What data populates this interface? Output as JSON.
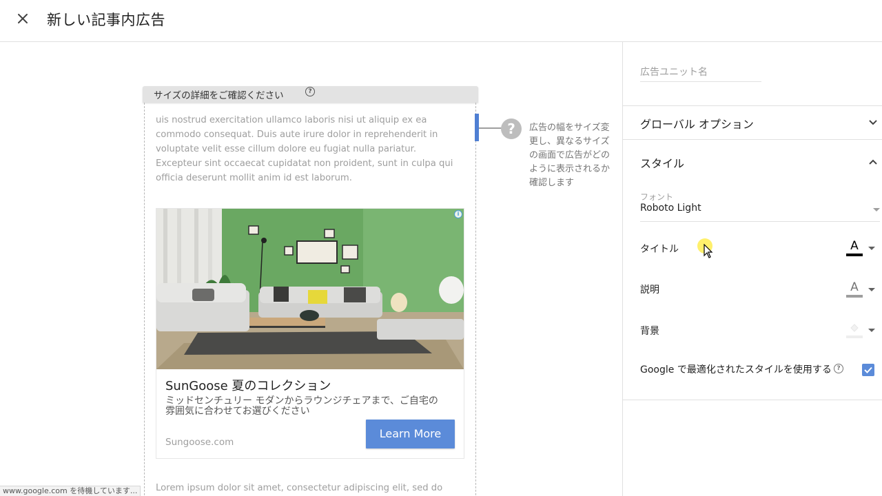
{
  "header": {
    "title": "新しい記事内広告"
  },
  "preview": {
    "frame_label": "サイズの詳細をご確認ください",
    "frame_help": "?",
    "help_text": "広告の幅をサイズ変更し、異なるサイズの画面で広告がどのように表示されるか確認します",
    "lorem_top": "uis nostrud exercitation ullamco laboris nisi ut aliquip ex ea commodo consequat. Duis aute irure dolor in reprehenderit in voluptate velit esse cillum dolore eu fugiat nulla pariatur. Excepteur sint occaecat cupidatat non proident, sunt in culpa qui officia deserunt mollit anim id est laborum.",
    "lorem_bottom": "Lorem ipsum dolor sit amet, consectetur adipiscing elit, sed do",
    "ad": {
      "title": "SunGoose 夏のコレクション",
      "description": "ミッドセンチュリー モダンからラウンジチェアまで、ご自宅の雰囲気に合わせてお選びください",
      "domain": "Sungoose.com",
      "cta": "Learn More",
      "adchoices": "i"
    }
  },
  "status_bar": "www.google.com を待機しています...",
  "sidebar": {
    "unit_name_placeholder": "広告ユニット名",
    "global_options": "グローバル オプション",
    "style_section": "スタイル",
    "font_label": "フォント",
    "font_value": "Roboto Light",
    "title_label": "タイトル",
    "description_label": "説明",
    "background_label": "背景",
    "google_style_label": "Google で最適化されたスタイルを使用する",
    "google_style_checked": true,
    "title_color": "#000000",
    "description_color": "#9e9e9e",
    "background_color": "#eeeeee",
    "accent_color": "#5b8bd9"
  }
}
